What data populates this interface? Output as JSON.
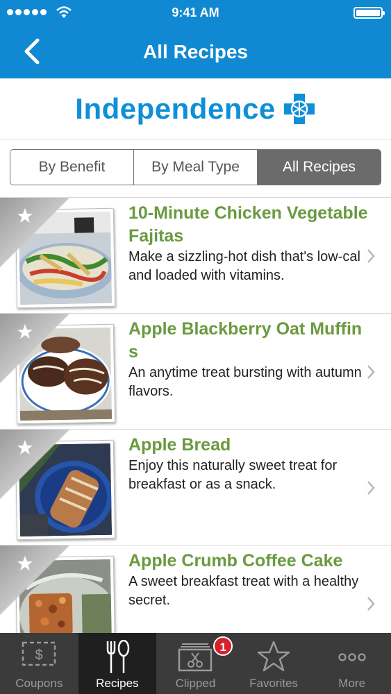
{
  "status_bar": {
    "time": "9:41 AM"
  },
  "nav": {
    "title": "All Recipes"
  },
  "brand": {
    "name": "Independence"
  },
  "segments": [
    {
      "label": "By Benefit",
      "active": false
    },
    {
      "label": "By Meal Type",
      "active": false
    },
    {
      "label": "All Recipes",
      "active": true
    }
  ],
  "recipes": [
    {
      "title": "10-Minute Chicken Vegetable Fajitas",
      "description": "Make a sizzling-hot dish that's low-cal and loaded with vitamins."
    },
    {
      "title": "Apple Blackberry Oat Muffins",
      "description": "An anytime treat bursting with autumn flavors."
    },
    {
      "title": "Apple Bread",
      "description": "Enjoy this naturally sweet treat for breakfast or as a snack."
    },
    {
      "title": "Apple Crumb Coffee Cake",
      "description": "A sweet breakfast treat with a healthy secret."
    }
  ],
  "tabs": [
    {
      "label": "Coupons",
      "icon": "coupon-icon",
      "active": false
    },
    {
      "label": "Recipes",
      "icon": "fork-spoon-icon",
      "active": true
    },
    {
      "label": "Clipped",
      "icon": "scissors-box-icon",
      "active": false,
      "badge": "1"
    },
    {
      "label": "Favorites",
      "icon": "star-icon",
      "active": false
    },
    {
      "label": "More",
      "icon": "more-dots-icon",
      "active": false
    }
  ],
  "colors": {
    "nav_blue": "#1189d2",
    "title_green": "#6a9a3f",
    "brand_blue": "#0f8fd8",
    "badge_red": "#d6202a"
  }
}
